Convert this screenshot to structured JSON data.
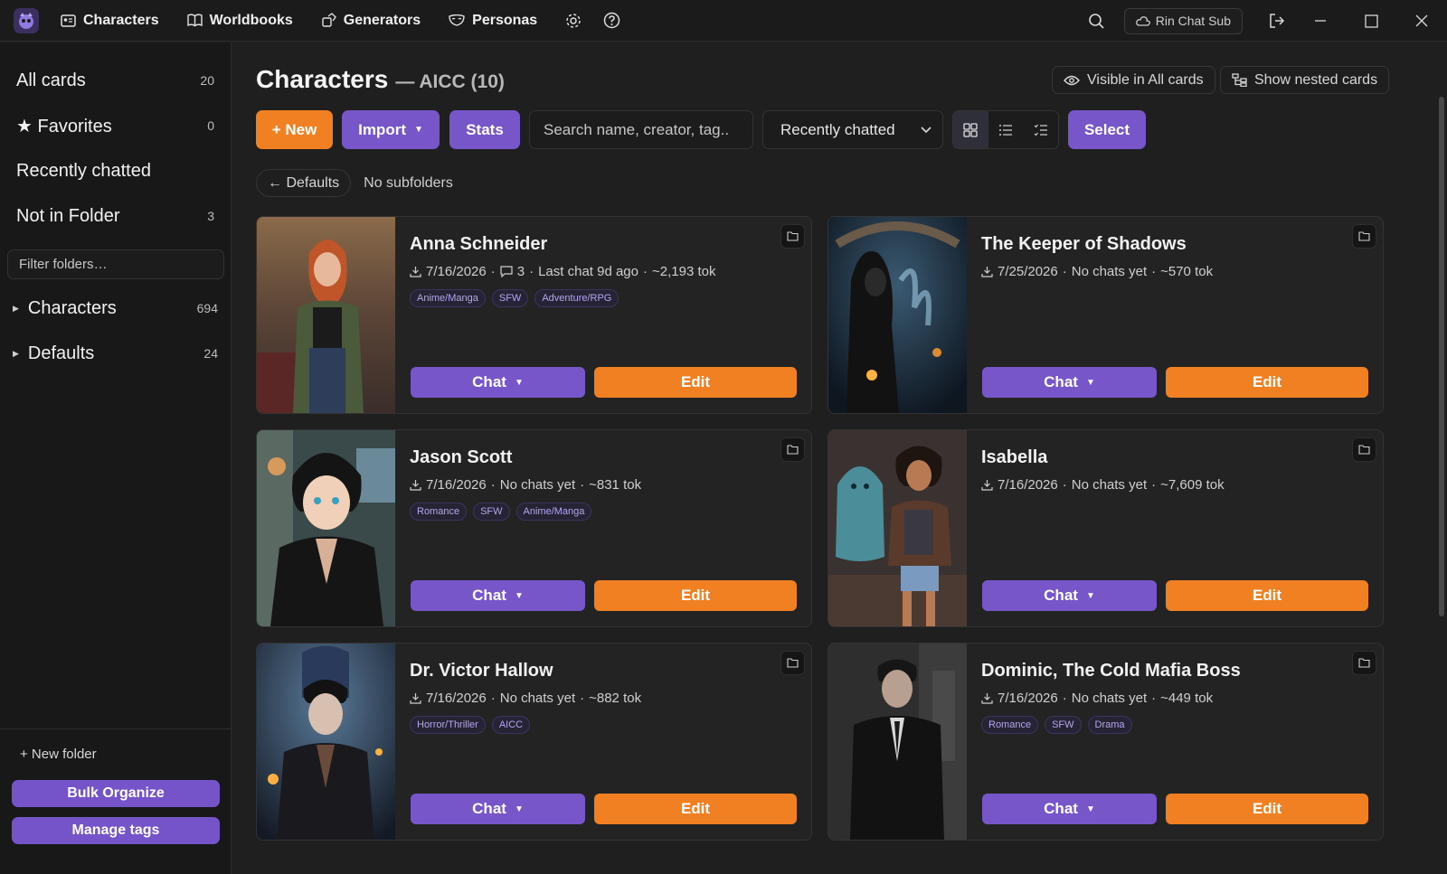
{
  "nav": {
    "items": [
      {
        "label": "Characters",
        "icon": "id-card-icon"
      },
      {
        "label": "Worldbooks",
        "icon": "book-icon"
      },
      {
        "label": "Generators",
        "icon": "generator-icon"
      },
      {
        "label": "Personas",
        "icon": "mask-icon"
      }
    ],
    "account_label": "Rin Chat Sub"
  },
  "sidebar": {
    "quick": [
      {
        "label": "All cards",
        "count": "20"
      },
      {
        "label": "★ Favorites",
        "count": "0"
      },
      {
        "label": "Recently chatted",
        "count": ""
      },
      {
        "label": "Not in Folder",
        "count": "3"
      }
    ],
    "filter_placeholder": "Filter folders…",
    "folders": [
      {
        "label": "Characters",
        "count": "694"
      },
      {
        "label": "Defaults",
        "count": "24"
      }
    ],
    "new_folder": "+ New folder",
    "bulk_organize": "Bulk Organize",
    "manage_tags": "Manage tags"
  },
  "header": {
    "title": "Characters",
    "subtitle": "— AICC (10)",
    "visible_label": "Visible in All cards",
    "nested_label": "Show nested cards"
  },
  "toolbar": {
    "new_label": "+ New",
    "import_label": "Import",
    "stats_label": "Stats",
    "search_placeholder": "Search name, creator, tag..",
    "sort_value": "Recently chatted",
    "select_label": "Select"
  },
  "breadcrumb": {
    "back_label": "← Defaults",
    "status": "No subfolders"
  },
  "cards": [
    {
      "name": "Anna Schneider",
      "date": "7/16/2026",
      "chats": "3",
      "stat": "Last chat 9d ago",
      "tokens": "~2,193 tok",
      "tags": [
        "Anime/Manga",
        "SFW",
        "Adventure/RPG"
      ]
    },
    {
      "name": "The Keeper of Shadows",
      "date": "7/25/2026",
      "chats": "",
      "stat": "No chats yet",
      "tokens": "~570 tok",
      "tags": []
    },
    {
      "name": "Jason Scott",
      "date": "7/16/2026",
      "chats": "",
      "stat": "No chats yet",
      "tokens": "~831 tok",
      "tags": [
        "Romance",
        "SFW",
        "Anime/Manga"
      ]
    },
    {
      "name": "Isabella",
      "date": "7/16/2026",
      "chats": "",
      "stat": "No chats yet",
      "tokens": "~7,609 tok",
      "tags": []
    },
    {
      "name": "Dr. Victor Hallow",
      "date": "7/16/2026",
      "chats": "",
      "stat": "No chats yet",
      "tokens": "~882 tok",
      "tags": [
        "Horror/Thriller",
        "AICC"
      ]
    },
    {
      "name": "Dominic, The Cold Mafia Boss",
      "date": "7/16/2026",
      "chats": "",
      "stat": "No chats yet",
      "tokens": "~449 tok",
      "tags": [
        "Romance",
        "SFW",
        "Drama"
      ]
    }
  ],
  "card_actions": {
    "chat_label": "Chat",
    "edit_label": "Edit"
  },
  "colors": {
    "accent_purple": "#7656c8",
    "accent_orange": "#f08022",
    "tag_text": "#b6a6f0"
  }
}
